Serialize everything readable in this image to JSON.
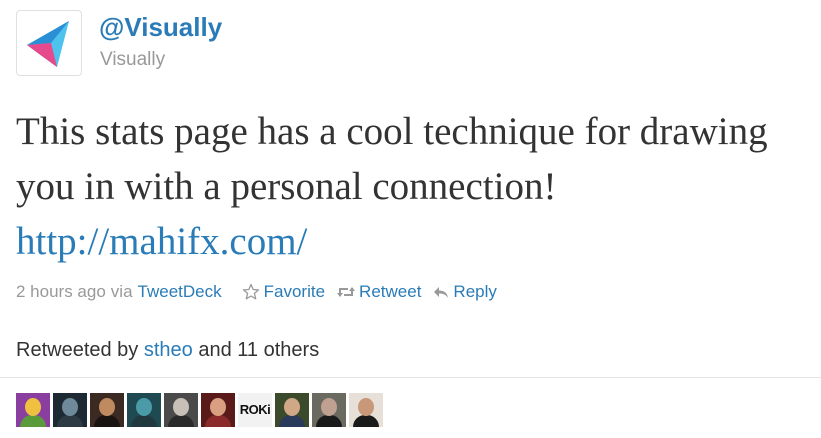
{
  "author": {
    "screen_name": "@Visually",
    "full_name": "Visually",
    "avatar_icon": "visually-logo-icon"
  },
  "tweet": {
    "text": "This stats page has a cool technique for drawing you in with a personal connection! ",
    "link": "http://mahifx.com/"
  },
  "meta": {
    "time": "2 hours ago",
    "via_label": "via",
    "client": "TweetDeck"
  },
  "actions": {
    "favorite": "Favorite",
    "retweet": "Retweet",
    "reply": "Reply"
  },
  "retweets": {
    "prefix": "Retweeted by",
    "user": "stheo",
    "suffix": "and 11 others",
    "avatars": [
      {
        "bg": "#8a3fa0",
        "face": "#f0c040",
        "body": "#5a9a3a"
      },
      {
        "bg": "#1d2a33",
        "face": "#6e8a9a",
        "body": "#2d3a44"
      },
      {
        "bg": "#3a2a22",
        "face": "#c08a60",
        "body": "#1a1410"
      },
      {
        "bg": "#1f4a52",
        "face": "#4a9aa8",
        "body": "#20383e"
      },
      {
        "bg": "#4a4a4a",
        "face": "#c8c0b8",
        "body": "#2a2a2a"
      },
      {
        "bg": "#5a1a1a",
        "face": "#d8a080",
        "body": "#8a2a2a"
      },
      {
        "bg": "#f2f2f2",
        "logo": "ROKi"
      },
      {
        "bg": "#3a4a2a",
        "face": "#d0a888",
        "body": "#2a3a5a"
      },
      {
        "bg": "#6a6a60",
        "face": "#c0a090",
        "body": "#1a1a1a"
      },
      {
        "bg": "#e6e0d8",
        "face": "#c89878",
        "body": "#1a1a1a"
      }
    ]
  }
}
